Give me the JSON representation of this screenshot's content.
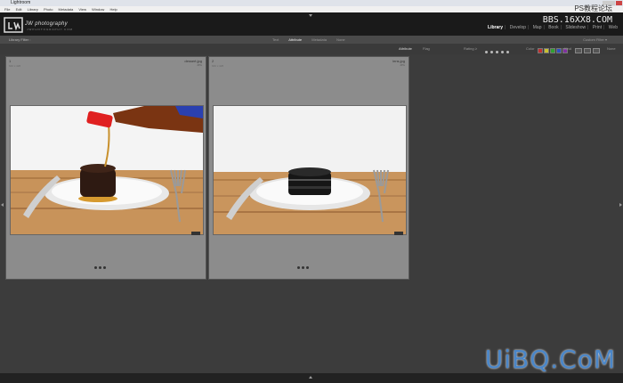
{
  "window": {
    "title": "Lightroom"
  },
  "menu": [
    "File",
    "Edit",
    "Library",
    "Photo",
    "Metadata",
    "View",
    "Window",
    "Help"
  ],
  "identity": {
    "logo_text": "JW photography",
    "logo_sub": "JWPHOTOGRAPHY.COM"
  },
  "watermark": {
    "line1": "PS教程论坛",
    "line2": "BBS.16XX8.COM",
    "bottom": "UiBQ.CoM"
  },
  "modules": [
    "Library",
    "Develop",
    "Map",
    "Book",
    "Slideshow",
    "Print",
    "Web"
  ],
  "active_module": "Library",
  "filter_bar": {
    "title": "Library Filter :",
    "tabs": [
      "Text",
      "Attribute",
      "Metadata",
      "None"
    ],
    "active_tab": "Attribute",
    "custom": "Custom Filter ▾"
  },
  "attribute_bar": {
    "label": "Attribute",
    "flag": "Flag",
    "rating_label": "Rating",
    "rating_op": "≥",
    "color_label": "Color",
    "kind_label": "Kind",
    "none_label": "None",
    "swatch_colors": [
      "#c03030",
      "#c8c030",
      "#30a030",
      "#3050c0",
      "#8030a0"
    ]
  },
  "photos": [
    {
      "index": "1",
      "meta": "640 x 426",
      "filename": "dessert.jpg",
      "ext": "JPG"
    },
    {
      "index": "2",
      "meta": "640 x 426",
      "filename": "lens.jpg",
      "ext": "JPG"
    }
  ],
  "icons": {
    "logo": "camera-logo-icon",
    "rating": "star-icon",
    "collapse": "triangle-icon"
  }
}
